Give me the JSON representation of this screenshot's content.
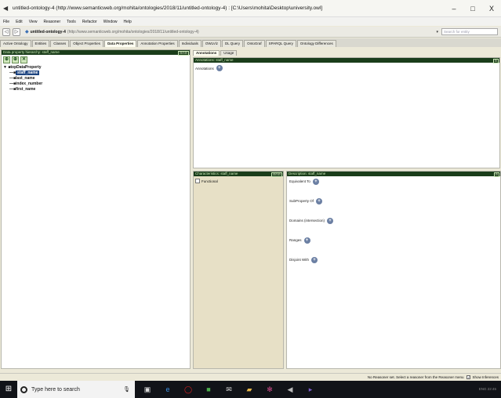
{
  "window": {
    "title": "untitled-ontology-4 (http://www.semanticweb.org/mohita/ontologies/2018/11/untitled-ontology-4) : [C:\\Users\\mohita\\Desktop\\university.owl]",
    "minimize": "–",
    "maximize": "□",
    "close": "X"
  },
  "menu": [
    "File",
    "Edit",
    "View",
    "Reasoner",
    "Tools",
    "Refactor",
    "Window",
    "Help"
  ],
  "address": {
    "back": "◁",
    "forward": "▷",
    "ontology": "untitled-ontology-4",
    "uri": "(http://www.semanticweb.org/mohita/ontologies/2018/11/untitled-ontology-4)",
    "search_placeholder": "Search for entity",
    "dropdown": "▾"
  },
  "tabs": [
    "Active Ontology",
    "Entities",
    "Classes",
    "Object Properties",
    "Data Properties",
    "Annotation Properties",
    "Individuals",
    "OWLViz",
    "DL Query",
    "OntoGraf",
    "SPARQL Query",
    "Ontology Differences"
  ],
  "active_tab": 4,
  "hierarchy": {
    "header": "Data property hierarchy: staff_name",
    "ctrl": "⊟⊟⊟",
    "tool_add_sub": "⊕",
    "tool_add_sib": "⊕",
    "tool_delete": "✕",
    "root": "topDataProperty",
    "items": [
      "staff_name",
      "last_name",
      "index_number",
      "first_name"
    ],
    "selected_index": 0
  },
  "annotation": {
    "tab1": "Annotations",
    "tab2": "Usage",
    "header": "Annotations: staff_name",
    "ctrl": "⊟",
    "label": "Annotations",
    "add": "+"
  },
  "characteristics": {
    "header": "Characteristics: staff_name",
    "ctrl": "⊟⊟⊟",
    "functional": "Functional"
  },
  "description": {
    "header": "Description: staff_name",
    "ctrl": "⊟",
    "rows": [
      "Equivalent To",
      "SubProperty Of",
      "Domains (intersection)",
      "Ranges",
      "Disjoint With"
    ],
    "add": "+"
  },
  "status": {
    "text": "No Reasoner set. Select a reasoner from the Reasoner menu",
    "show_inferences": "Show Inferences"
  },
  "taskbar": {
    "search_text": "Type here to search",
    "tray": "ENG  22:45"
  }
}
